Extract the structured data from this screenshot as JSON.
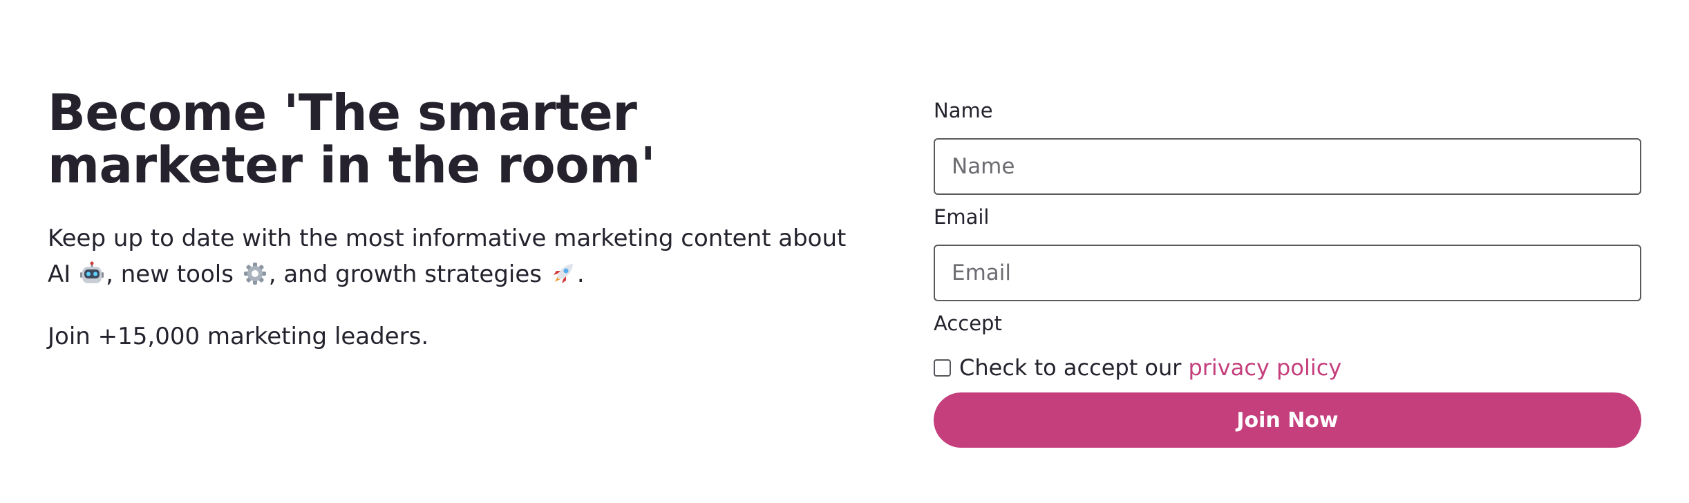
{
  "hero": {
    "title": "Become 'The smarter marketer in the room'",
    "description_part1": "Keep up to date with the most informative marketing content about AI",
    "description_part2": ", new tools",
    "description_part3": ", and growth strategies",
    "description_part4": ".",
    "join_text": "Join +15,000 marketing leaders."
  },
  "icons": {
    "robot": "robot-emoji",
    "gear": "gear-emoji",
    "rocket": "rocket-emoji"
  },
  "form": {
    "name_label": "Name",
    "name_placeholder": "Name",
    "email_label": "Email",
    "email_placeholder": "Email",
    "accept_label": "Accept",
    "checkbox_text": "Check to accept our",
    "privacy_link_text": "privacy policy",
    "checkbox_checked": false,
    "submit_label": "Join Now"
  },
  "colors": {
    "accent": "#c43f7c",
    "text": "#25222d",
    "background": "#ffffff"
  }
}
